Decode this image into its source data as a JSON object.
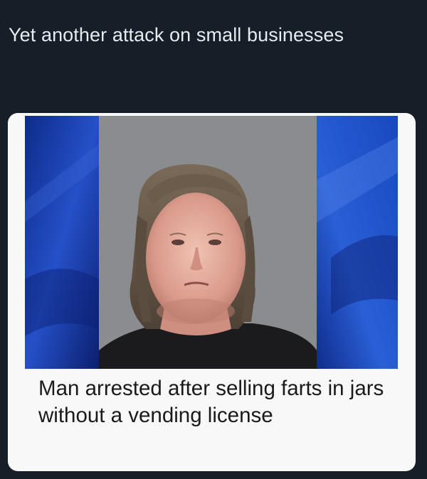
{
  "tweet": {
    "text": "Yet another attack on small businesses"
  },
  "card": {
    "headline": "Man arrested after selling farts in jars without a vending license"
  },
  "colors": {
    "background": "#161e27",
    "tweet_text": "#e7ebef",
    "card_background": "#f8f8f8",
    "photo_side_blue": "#1a3aa8",
    "mugshot_backdrop": "#8a8c90"
  }
}
